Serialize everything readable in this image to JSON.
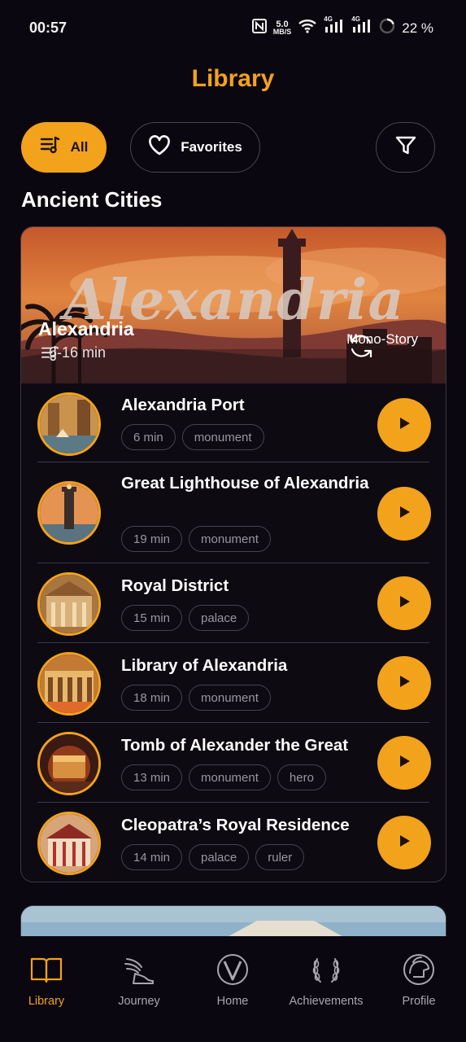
{
  "status_bar": {
    "time": "00:57",
    "speed_value": "5.0",
    "speed_unit": "MB/S",
    "network_a": "4G",
    "network_b": "4G",
    "battery": "22 %"
  },
  "page": {
    "title": "Library"
  },
  "filters": {
    "all_label": "All",
    "favorites_label": "Favorites"
  },
  "section": {
    "title": "Ancient Cities"
  },
  "collection": {
    "banner_text": "Alexandria",
    "name": "Alexandria",
    "duration": "6-16 min",
    "mode_label": "Mono-Story",
    "stories": [
      {
        "title": "Alexandria Port",
        "tags": [
          "6 min",
          "monument"
        ]
      },
      {
        "title": "Great Lighthouse of Alexandria",
        "tags": [
          "19 min",
          "monument"
        ]
      },
      {
        "title": "Royal District",
        "tags": [
          "15 min",
          "palace"
        ]
      },
      {
        "title": "Library of Alexandria",
        "tags": [
          "18 min",
          "monument"
        ]
      },
      {
        "title": "Tomb of Alexander the Great",
        "tags": [
          "13 min",
          "monument",
          "hero"
        ]
      },
      {
        "title": "Cleopatra’s Royal Residence",
        "tags": [
          "14 min",
          "palace",
          "ruler"
        ]
      }
    ]
  },
  "nav": {
    "items": [
      {
        "label": "Library",
        "icon": "book-icon",
        "active": true
      },
      {
        "label": "Journey",
        "icon": "winged-sandal-icon",
        "active": false
      },
      {
        "label": "Home",
        "icon": "v-logo-icon",
        "active": false
      },
      {
        "label": "Achievements",
        "icon": "laurel-wreath-icon",
        "active": false
      },
      {
        "label": "Profile",
        "icon": "athena-helmet-icon",
        "active": false
      }
    ]
  },
  "colors": {
    "accent": "#f3a21c",
    "background": "#0b0710",
    "card_border": "#3c3842",
    "tag_text": "#9a969f"
  }
}
